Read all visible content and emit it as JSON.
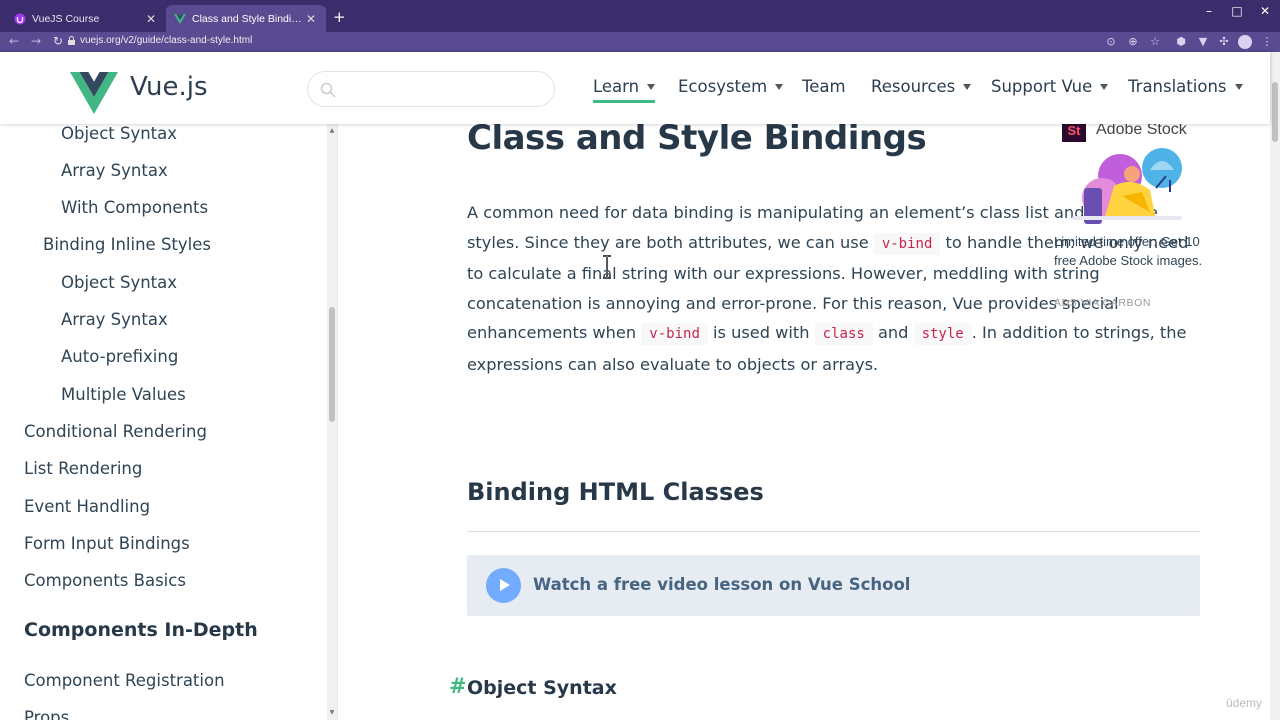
{
  "browser": {
    "tabs": [
      {
        "label": "VueJS Course",
        "active": false
      },
      {
        "label": "Class and Style Bindings — Vue.js",
        "active": true
      }
    ],
    "new_tab": "+",
    "window_controls": {
      "minimize": "–",
      "maximize": "□",
      "close": "✕"
    },
    "url": "vuejs.org/v2/guide/class-and-style.html",
    "nav": {
      "back": "←",
      "forward": "→",
      "reload": "↻"
    },
    "toolbar_icons": [
      "location-icon",
      "zoom-icon",
      "star-icon",
      "shield-icon",
      "vue-devtools-icon",
      "extensions-icon",
      "profile-icon",
      "menu-icon"
    ]
  },
  "header": {
    "brand": "Vue.js",
    "search_placeholder": "",
    "nav": [
      {
        "label": "Learn",
        "dropdown": true,
        "active": true
      },
      {
        "label": "Ecosystem",
        "dropdown": true
      },
      {
        "label": "Team",
        "dropdown": false
      },
      {
        "label": "Resources",
        "dropdown": true
      },
      {
        "label": "Support Vue",
        "dropdown": true
      },
      {
        "label": "Translations",
        "dropdown": true
      }
    ],
    "accent": "#42b983"
  },
  "sidebar": {
    "items": [
      {
        "label": "Object Syntax",
        "level": 3
      },
      {
        "label": "Array Syntax",
        "level": 3
      },
      {
        "label": "With Components",
        "level": 3
      },
      {
        "label": "Binding Inline Styles",
        "level": 2
      },
      {
        "label": "Object Syntax",
        "level": 3
      },
      {
        "label": "Array Syntax",
        "level": 3
      },
      {
        "label": "Auto-prefixing",
        "level": 3
      },
      {
        "label": "Multiple Values",
        "level": 3
      },
      {
        "label": "Conditional Rendering",
        "level": 1
      },
      {
        "label": "List Rendering",
        "level": 1
      },
      {
        "label": "Event Handling",
        "level": 1
      },
      {
        "label": "Form Input Bindings",
        "level": 1
      },
      {
        "label": "Components Basics",
        "level": 1
      }
    ],
    "section_heading": "Components In-Depth",
    "section_items": [
      {
        "label": "Component Registration"
      },
      {
        "label": "Props"
      }
    ]
  },
  "content": {
    "title": "Class and Style Bindings",
    "intro": {
      "t1": "A common need for data binding is manipulating an element’s class list and its inline styles. Since they are both attributes, we can use ",
      "c1": "v-bind",
      "t2": " to handle them: we only need to calculate a final string with our expressions. However, meddling with string concatenation is annoying and error-prone. For this reason, Vue provides special enhancements when ",
      "c2": "v-bind",
      "t3": " is used with ",
      "c3": "class",
      "t4": " and ",
      "c4": "style",
      "t5": ". In addition to strings, the expressions can also evaluate to objects or arrays."
    },
    "section_title": "Binding HTML Classes",
    "video_link": "Watch a free video lesson on Vue School",
    "subsection_hash": "#",
    "subsection_title": "Object Syntax"
  },
  "ad": {
    "logo": "St",
    "brand": "Adobe Stock",
    "text": "Limited time offer: Get 10 free Adobe Stock images.",
    "via": "ADS VIA CARBON"
  },
  "watermark": "ûdemy"
}
